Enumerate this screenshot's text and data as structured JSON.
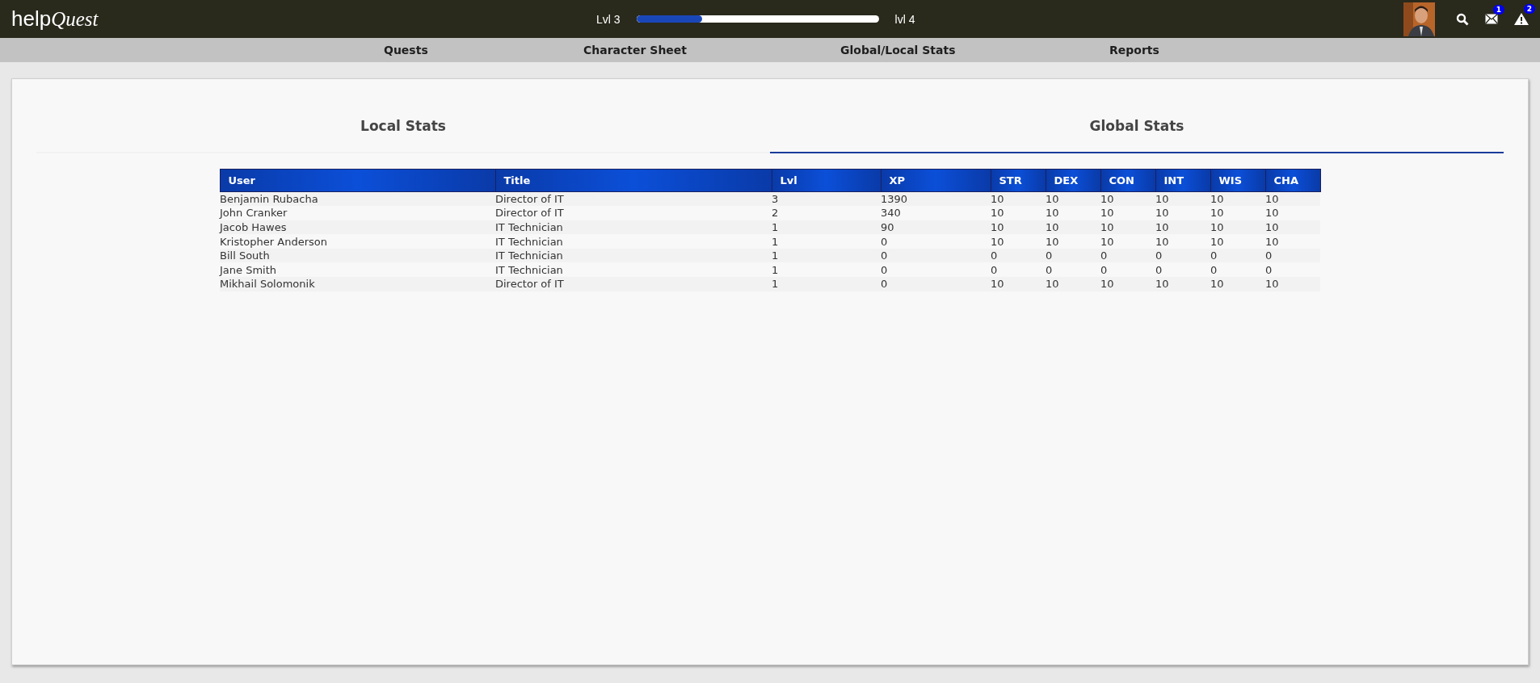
{
  "topbar": {
    "logo": {
      "first": "help",
      "second": "Quest"
    },
    "progress": {
      "from": "Lvl 3",
      "to": "lvl 4",
      "level": 0.27
    },
    "mail_badge": "1",
    "alert_badge": "2"
  },
  "nav": [
    {
      "label": "Quests"
    },
    {
      "label": "Character Sheet"
    },
    {
      "label": "Global/Local Stats"
    },
    {
      "label": "Reports"
    }
  ],
  "tabs": [
    {
      "label": "Local Stats",
      "selected": false
    },
    {
      "label": "Global Stats",
      "selected": true
    }
  ],
  "table": {
    "columns": [
      "User",
      "Title",
      "Lvl",
      "XP",
      "STR",
      "DEX",
      "CON",
      "INT",
      "WIS",
      "CHA"
    ],
    "rows": [
      [
        "Benjamin Rubacha",
        "Director of IT",
        "3",
        "1390",
        "10",
        "10",
        "10",
        "10",
        "10",
        "10"
      ],
      [
        "John Cranker",
        "Director of IT",
        "2",
        "340",
        "10",
        "10",
        "10",
        "10",
        "10",
        "10"
      ],
      [
        "Jacob Hawes",
        "IT Technician",
        "1",
        "90",
        "10",
        "10",
        "10",
        "10",
        "10",
        "10"
      ],
      [
        "Kristopher Anderson",
        "IT Technician",
        "1",
        "0",
        "10",
        "10",
        "10",
        "10",
        "10",
        "10"
      ],
      [
        "Bill South",
        "IT Technician",
        "1",
        "0",
        "0",
        "0",
        "0",
        "0",
        "0",
        "0"
      ],
      [
        "Jane Smith",
        "IT Technician",
        "1",
        "0",
        "0",
        "0",
        "0",
        "0",
        "0",
        "0"
      ],
      [
        "Mikhail Solomonik",
        "Director of IT",
        "1",
        "0",
        "10",
        "10",
        "10",
        "10",
        "10",
        "10"
      ]
    ]
  }
}
